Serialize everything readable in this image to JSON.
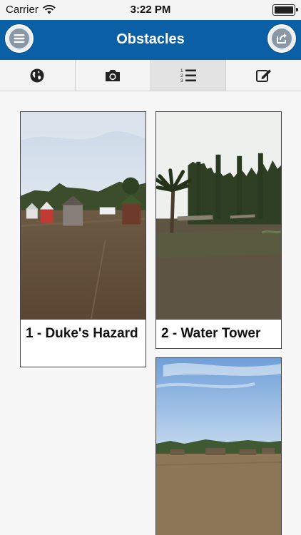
{
  "status_bar": {
    "carrier": "Carrier",
    "time": "3:22 PM",
    "icons": [
      "wifi-icon",
      "battery-icon"
    ]
  },
  "nav_bar": {
    "title": "Obstacles",
    "left_button_icon": "menu-icon",
    "right_button_icon": "share-icon",
    "color": "#0b5fa5"
  },
  "tabs": [
    {
      "icon": "globe-icon",
      "active": false
    },
    {
      "icon": "camera-icon",
      "active": false
    },
    {
      "icon": "numbered-list-icon",
      "active": true
    },
    {
      "icon": "edit-icon",
      "active": false
    }
  ],
  "obstacles": [
    {
      "caption": "1 - Duke's Hazard",
      "photo": "field with small painted wooden houses"
    },
    {
      "caption": "2 - Water Tower",
      "photo": "palm tree and row of tall poplar trees beside a field"
    },
    {
      "caption": "",
      "photo": "open field with wooden log obstacles under blue sky"
    }
  ]
}
